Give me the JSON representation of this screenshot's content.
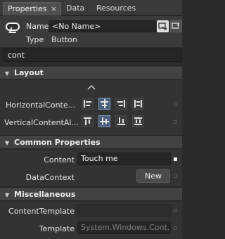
{
  "tabs": [
    {
      "label": "Properties",
      "close": "×"
    },
    {
      "label": "Data"
    },
    {
      "label": "Resources"
    }
  ],
  "object": {
    "name_label": "Name",
    "name_value": "<No Name>",
    "type_label": "Type",
    "type_value": "Button",
    "icon": "button-icon"
  },
  "search": {
    "value": "cont"
  },
  "layout": {
    "title": "Layout",
    "advanced_icon": "chevron-up-icon",
    "rows": [
      {
        "label": "HorizontalConte...",
        "options": [
          "align-left",
          "align-center",
          "align-right",
          "align-stretch"
        ],
        "selected": 1
      },
      {
        "label": "VerticalContentAl...",
        "options": [
          "align-top",
          "align-center",
          "align-bottom",
          "align-stretch"
        ],
        "selected": 1
      }
    ]
  },
  "common": {
    "title": "Common Properties",
    "content_label": "Content",
    "content_value": "Touch me",
    "datacontext_label": "DataContext",
    "new_button": "New"
  },
  "misc": {
    "title": "Miscellaneous",
    "contenttemplate_label": "ContentTemplate",
    "contenttemplate_value": "",
    "template_label": "Template",
    "template_value": "System.Windows.Cont..."
  }
}
